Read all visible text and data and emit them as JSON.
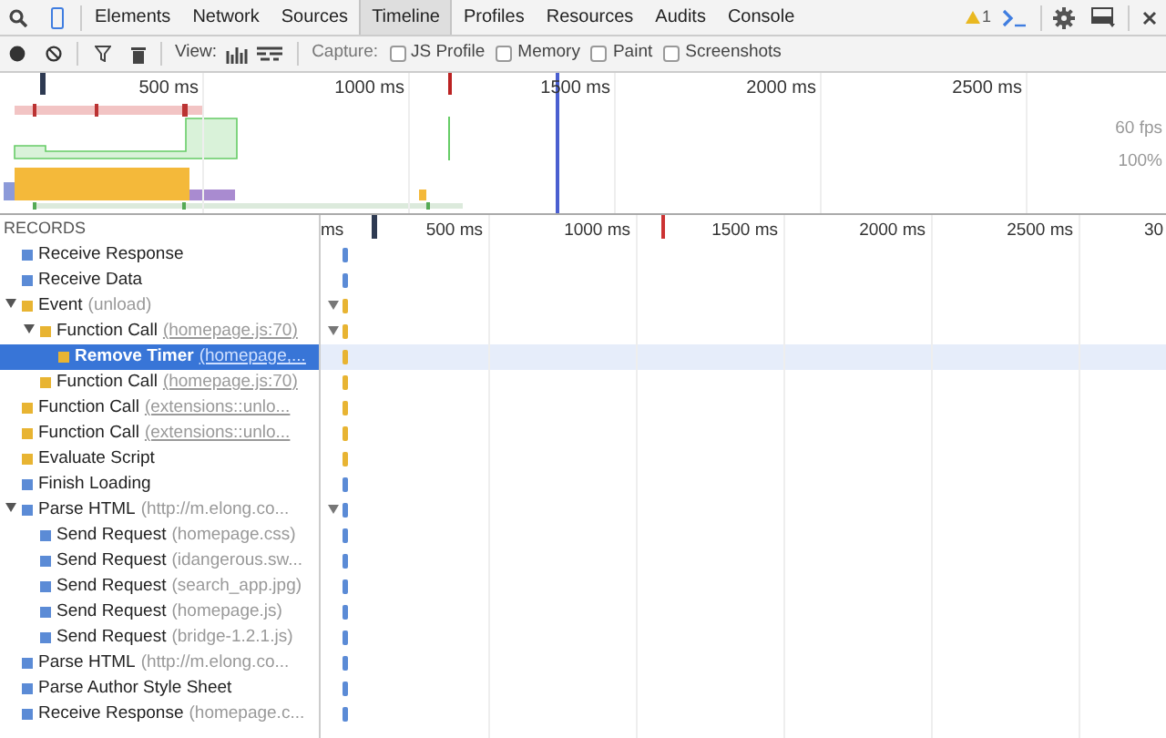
{
  "tabs": [
    {
      "label": "Elements",
      "selected": false
    },
    {
      "label": "Network",
      "selected": false
    },
    {
      "label": "Sources",
      "selected": false
    },
    {
      "label": "Timeline",
      "selected": true
    },
    {
      "label": "Profiles",
      "selected": false
    },
    {
      "label": "Resources",
      "selected": false
    },
    {
      "label": "Audits",
      "selected": false
    },
    {
      "label": "Console",
      "selected": false
    }
  ],
  "warnings": "1",
  "toolbar": {
    "view_label": "View:",
    "capture_label": "Capture:",
    "capture": [
      {
        "label": "JS Profile",
        "checked": false
      },
      {
        "label": "Memory",
        "checked": false
      },
      {
        "label": "Paint",
        "checked": false
      },
      {
        "label": "Screenshots",
        "checked": false
      }
    ]
  },
  "overview": {
    "ticks": [
      "500 ms",
      "1000 ms",
      "1500 ms",
      "2000 ms",
      "2500 ms"
    ],
    "fps_label": "60 fps",
    "cpu_label": "100%"
  },
  "records_title": "RECORDS",
  "records": [
    {
      "title": "Receive Response",
      "color": "#5b8bd6",
      "selected": false
    },
    {
      "title": "Receive Data",
      "color": "#5b8bd6",
      "selected": false
    },
    {
      "title": "Event",
      "detail": "(unload)",
      "color": "#e8b432",
      "expanded": true,
      "selected": false,
      "children": [
        {
          "title": "Function Call",
          "detail": "(homepage.js:70)",
          "link": true,
          "color": "#e8b432",
          "expanded": true,
          "selected": false,
          "children": [
            {
              "title": "Remove Timer",
              "detail": "(homepage,...",
              "link": true,
              "color": "#e8b432",
              "selected": true
            }
          ]
        },
        {
          "title": "Function Call",
          "detail": "(homepage.js:70)",
          "link": true,
          "color": "#e8b432",
          "selected": false
        }
      ]
    },
    {
      "title": "Function Call",
      "detail": "(extensions::unlo...",
      "link": true,
      "color": "#e8b432",
      "selected": false
    },
    {
      "title": "Function Call",
      "detail": "(extensions::unlo...",
      "link": true,
      "color": "#e8b432",
      "selected": false
    },
    {
      "title": "Evaluate Script",
      "color": "#e8b432",
      "selected": false
    },
    {
      "title": "Finish Loading",
      "color": "#5b8bd6",
      "selected": false
    },
    {
      "title": "Parse HTML",
      "detail": "(http://m.elong.co...",
      "color": "#5b8bd6",
      "expanded": true,
      "selected": false,
      "children": [
        {
          "title": "Send Request",
          "detail": "(homepage.css)",
          "color": "#5b8bd6",
          "selected": false
        },
        {
          "title": "Send Request",
          "detail": "(idangerous.sw...",
          "color": "#5b8bd6",
          "selected": false
        },
        {
          "title": "Send Request",
          "detail": "(search_app.jpg)",
          "color": "#5b8bd6",
          "selected": false
        },
        {
          "title": "Send Request",
          "detail": "(homepage.js)",
          "color": "#5b8bd6",
          "selected": false
        },
        {
          "title": "Send Request",
          "detail": "(bridge-1.2.1.js)",
          "color": "#5b8bd6",
          "selected": false
        }
      ]
    },
    {
      "title": "Parse HTML",
      "detail": "(http://m.elong.co...",
      "color": "#5b8bd6",
      "selected": false
    },
    {
      "title": "Parse Author Style Sheet",
      "color": "#5b8bd6",
      "selected": false
    },
    {
      "title": "Receive Response",
      "detail": "(homepage.c...",
      "color": "#5b8bd6",
      "selected": false
    }
  ],
  "timeline": {
    "ticks": [
      "ms",
      "500 ms",
      "1000 ms",
      "1500 ms",
      "2000 ms",
      "2500 ms",
      "30"
    ]
  }
}
